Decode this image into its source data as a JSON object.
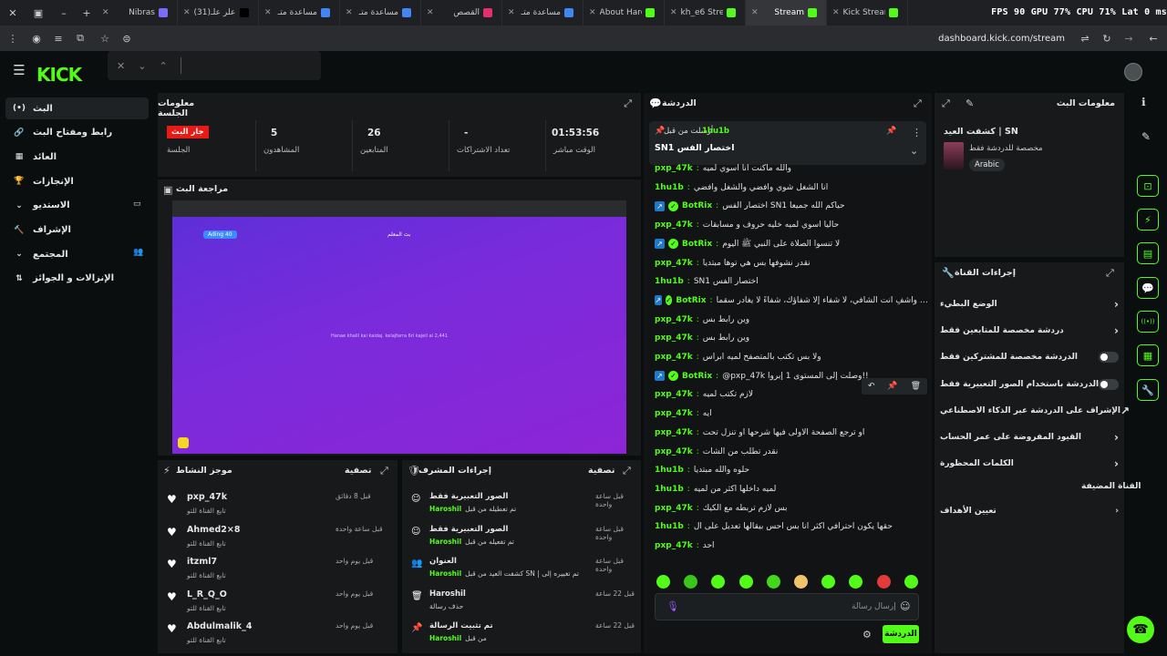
{
  "browser": {
    "tabs": [
      {
        "label": "Nibras",
        "color": "#7b6cff"
      },
      {
        "label": "(31)اعلر علـ",
        "color": "#000000"
      },
      {
        "label": "مساعدة متـ",
        "color": "#4285f4"
      },
      {
        "label": "مساعدة متـ",
        "color": "#4285f4"
      },
      {
        "label": "القصص",
        "color": "#e1306c"
      },
      {
        "label": "مساعدة متـ",
        "color": "#4285f4"
      },
      {
        "label": "About Haro",
        "color": "#53fc18"
      },
      {
        "label": "kh_e6 Stre",
        "color": "#53fc18"
      },
      {
        "label": "Stream",
        "color": "#53fc18"
      },
      {
        "label": "Kick Stream",
        "color": "#53fc18"
      }
    ],
    "hud": "FPS 90  GPU 77%  CPU 71%  Lat 0 ms",
    "address": "dashboard.kick.com/stream"
  },
  "logo": "KICK",
  "sidebar": [
    {
      "label": "البث",
      "icon": "broadcast-icon"
    },
    {
      "label": "رابط ومفتاح البث",
      "icon": "link-icon"
    },
    {
      "label": "العائد",
      "icon": "revenue-icon"
    },
    {
      "label": "الإنجازات",
      "icon": "trophy-icon"
    },
    {
      "label": "الاستديو",
      "icon": "studio-icon"
    },
    {
      "label": "الإشراف",
      "icon": "moderation-icon"
    },
    {
      "label": "المجتمع",
      "icon": "community-icon"
    },
    {
      "label": "الإنزالات و الجوائز",
      "icon": "drops-icon"
    }
  ],
  "session": {
    "title": "معلومات الجلسة",
    "stats": [
      {
        "value": "جار البث",
        "label": "الجلسة"
      },
      {
        "value": "5",
        "label": "المشاهدون"
      },
      {
        "value": "26",
        "label": "المتابعين"
      },
      {
        "value": "-",
        "label": "تعداد الاشتراكات"
      },
      {
        "value": "01:53:56",
        "label": "الوقت مباشر"
      }
    ]
  },
  "preview": {
    "title": "مراجعة البث",
    "tag": "Ading 40",
    "center_title": "بث المعلم",
    "center_sub": "Hanae khalil kai kaidaj. kelajfarra 6ri kajeil ai 2,441"
  },
  "activity": {
    "title": "موجز النشاط",
    "filter": "تصفية",
    "items": [
      {
        "name": "pxp_47k",
        "sub": "تابع القناة للتو",
        "time": "قبل 8 دقائق"
      },
      {
        "name": "Ahmed2×8",
        "sub": "تابع القناة للتو",
        "time": "قبل ساعة واحدة"
      },
      {
        "name": "itzml7",
        "sub": "تابع القناة للتو",
        "time": "قبل يوم واحد"
      },
      {
        "name": "L_R_Q_O",
        "sub": "تابع القناة للتو",
        "time": "قبل يوم واحد"
      },
      {
        "name": "Abdulmalik_4",
        "sub": "تابع القناة للتو",
        "time": "قبل يوم واحد"
      }
    ]
  },
  "mod_actions": {
    "title": "إجراءات المشرف",
    "filter": "تصفية",
    "items": [
      {
        "title": "الصور التعبيرية فقط",
        "by": "Haroshil",
        "prefix": "تم تعطيله من قبل",
        "time": "قبل ساعة واحدة"
      },
      {
        "title": "الصور التعبيرية فقط",
        "by": "Haroshil",
        "prefix": "تم تفعيله من قبل",
        "time": "قبل ساعة واحدة"
      },
      {
        "title": "العنوان",
        "by": "Haroshil",
        "prefix": "كشفت العيد من قبل SN | تم تغييره إلى",
        "time": "قبل ساعة واحدة"
      },
      {
        "title": "Haroshil",
        "by": "",
        "prefix": "حذف رسالة",
        "time": "قبل 22 ساعة"
      },
      {
        "title": "تم تثبيت الرسالة",
        "by": "Haroshil",
        "prefix": "من قبل",
        "time": "قبل 22 ساعة"
      }
    ]
  },
  "chat": {
    "title": "الدردشة",
    "pinned_user": "1hu1b",
    "pinned_prefix": "أرسلت من قبل",
    "pinned_text": "SN1 اختصار الفس",
    "input_placeholder": "إرسال رسالة",
    "send_label": "الدردشة",
    "messages": [
      {
        "user": "pxp_47k",
        "text": "والله ماكنت انا اسوي لميه",
        "bot": false
      },
      {
        "user": "1hu1b",
        "text": "انا الشغل شوي وافضي والشغل وافضي",
        "bot": false
      },
      {
        "user": "BotRix",
        "text": "اختصار الفس SN1 حياكم الله جميعاً",
        "bot": true
      },
      {
        "user": "pxp_47k",
        "text": "حاليا اسوي لميه خليه حروف و مسابقات",
        "bot": false
      },
      {
        "user": "BotRix",
        "text": "لا تنسوا الصلاة على النبي ﷺ اليوم",
        "bot": true
      },
      {
        "user": "pxp_47k",
        "text": "نقدر نشوفها بس هي توها مبتديا",
        "bot": false
      },
      {
        "user": "1hu1b",
        "text": "SN1 اختصار الفس",
        "bot": false
      },
      {
        "user": "BotRix",
        "text": "اللهم رب الناس أذهب البأس، واشفِ أنت الشافي، لا شفاء إلا شفاؤك، شفاءً لا يغادر سقماً",
        "bot": true
      },
      {
        "user": "pxp_47k",
        "text": "وين رابط بس",
        "bot": false
      },
      {
        "user": "pxp_47k",
        "text": "وين رابط بس",
        "bot": false
      },
      {
        "user": "pxp_47k",
        "text": "ولا بس تكتب بالمتصفح لميه ابراس",
        "bot": false
      },
      {
        "user": "BotRix",
        "text": "@pxp_47k وصلت إلى المستوى 1 إبروا!!",
        "bot": true
      },
      {
        "user": "pxp_47k",
        "text": "لازم تكتب لميه",
        "bot": false
      },
      {
        "user": "pxp_47k",
        "text": "ايه",
        "bot": false
      },
      {
        "user": "pxp_47k",
        "text": "او ترجع الصفحة الاولى فيها شرحها او تنزل تحت",
        "bot": false
      },
      {
        "user": "pxp_47k",
        "text": "نقدر تطلب من الشات",
        "bot": false
      },
      {
        "user": "1hu1b",
        "text": "حلوه والله مبتديا",
        "bot": false
      },
      {
        "user": "1hu1b",
        "text": "لميه داخلها اكثر من لميه",
        "bot": false
      },
      {
        "user": "pxp_47k",
        "text": "بس لازم تربطه مع الكيك",
        "bot": false
      },
      {
        "user": "1hu1b",
        "text": "حقها يكون احترافي اكثر انا بس احس بيقالها تعديل على ال",
        "bot": false
      },
      {
        "user": "pxp_47k",
        "text": "احد",
        "bot": false
      }
    ]
  },
  "stream_info": {
    "title": "معلومات البث",
    "stream_title": "كشفت العيد | SN",
    "chat_mode": "مخصصة للدردشة فقط",
    "language": "Arabic"
  },
  "channel_settings": {
    "title": "إجراءات القناة",
    "rows": [
      {
        "label": "الوضع البطيء",
        "type": "arrow"
      },
      {
        "label": "دردشة مخصصة للمتابعين فقط",
        "type": "arrow"
      },
      {
        "label": "الدردشة مخصصة للمشتركين فقط",
        "type": "toggle"
      },
      {
        "label": "الدردشة باستخدام الصور التعبيرية فقط",
        "type": "toggle"
      },
      {
        "label": "الإشراف على الدردشة عبر الذكاء الاصطناعي",
        "type": "external"
      },
      {
        "label": "القيود المفروضة على عمر الحساب",
        "type": "arrow"
      },
      {
        "label": "الكلمات المحظورة",
        "type": "arrow"
      }
    ],
    "host_section": "القناة المضيفة",
    "host_target": "تعيين الأهداف"
  },
  "colors": {
    "accent": "#53fc18",
    "bg": "#0b0e0f",
    "panel": "#17191b",
    "live": "#e91916",
    "preview": "#7b2de0"
  }
}
